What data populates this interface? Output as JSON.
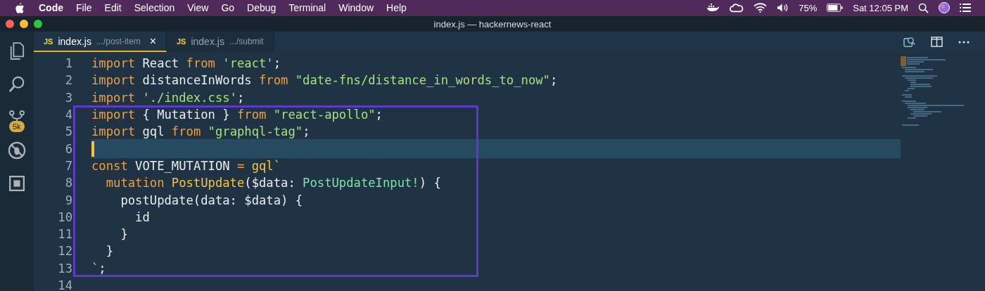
{
  "menubar": {
    "app_name": "Code",
    "menus": [
      "File",
      "Edit",
      "Selection",
      "View",
      "Go",
      "Debug",
      "Terminal",
      "Window",
      "Help"
    ],
    "battery": "75%",
    "clock": "Sat 12:05 PM"
  },
  "window": {
    "title": "index.js — hackernews-react"
  },
  "activity_bar": {
    "items": [
      {
        "kind": "files",
        "selected": false
      },
      {
        "kind": "search",
        "selected": false
      },
      {
        "kind": "source-control",
        "selected": false,
        "badge": "5k"
      },
      {
        "kind": "debug",
        "selected": false
      },
      {
        "kind": "extensions",
        "selected": false
      }
    ]
  },
  "tabs": [
    {
      "lang": "JS",
      "name": "index.js",
      "path": ".../post-item",
      "selected": true,
      "close": "×"
    },
    {
      "lang": "JS",
      "name": "index.js",
      "path": ".../submit",
      "selected": false
    }
  ],
  "editor": {
    "lines": [
      {
        "number": "1",
        "active": false,
        "tokens": [
          {
            "kind": "keyword",
            "text": "import"
          },
          {
            "kind": "plain",
            "text": " React "
          },
          {
            "kind": "keyword",
            "text": "from "
          },
          {
            "kind": "string",
            "text": "'react'"
          },
          {
            "kind": "plain",
            "text": ";"
          }
        ]
      },
      {
        "number": "2",
        "active": false,
        "tokens": [
          {
            "kind": "keyword",
            "text": "import"
          },
          {
            "kind": "plain",
            "text": " distanceInWords "
          },
          {
            "kind": "keyword",
            "text": "from "
          },
          {
            "kind": "string",
            "text": "\"date-fns/distance_in_words_to_now\""
          },
          {
            "kind": "plain",
            "text": ";"
          }
        ]
      },
      {
        "number": "3",
        "active": false,
        "tokens": [
          {
            "kind": "keyword",
            "text": "import "
          },
          {
            "kind": "string",
            "text": "'./index.css'"
          },
          {
            "kind": "plain",
            "text": ";"
          }
        ]
      },
      {
        "number": "4",
        "active": false,
        "tokens": [
          {
            "kind": "keyword",
            "text": "import"
          },
          {
            "kind": "plain",
            "text": " { Mutation } "
          },
          {
            "kind": "keyword",
            "text": "from "
          },
          {
            "kind": "string",
            "text": "\"react-apollo\""
          },
          {
            "kind": "plain",
            "text": ";"
          }
        ]
      },
      {
        "number": "5",
        "active": false,
        "tokens": [
          {
            "kind": "keyword",
            "text": "import"
          },
          {
            "kind": "plain",
            "text": " gql "
          },
          {
            "kind": "keyword",
            "text": "from "
          },
          {
            "kind": "string",
            "text": "\"graphql-tag\""
          },
          {
            "kind": "plain",
            "text": ";"
          }
        ]
      },
      {
        "number": "6",
        "active": true
      },
      {
        "number": "7",
        "active": false,
        "tokens": [
          {
            "kind": "keyword",
            "text": "const"
          },
          {
            "kind": "plain",
            "text": " VOTE_MUTATION "
          },
          {
            "kind": "keyword",
            "text": "= "
          },
          {
            "kind": "function",
            "text": "gql"
          },
          {
            "kind": "string",
            "text": "`"
          }
        ]
      },
      {
        "number": "8",
        "active": false,
        "tokens": [
          {
            "kind": "keyword",
            "text": "  mutation "
          },
          {
            "kind": "function",
            "text": "PostUpdate"
          },
          {
            "kind": "plain",
            "text": "($data: "
          },
          {
            "kind": "type",
            "text": "PostUpdateInput!"
          },
          {
            "kind": "plain",
            "text": ") {"
          }
        ]
      },
      {
        "number": "9",
        "active": false,
        "tokens": [
          {
            "kind": "plain",
            "text": "    postUpdate(data: $data) {"
          }
        ]
      },
      {
        "number": "10",
        "active": false,
        "tokens": [
          {
            "kind": "plain",
            "text": "      id"
          }
        ]
      },
      {
        "number": "11",
        "active": false,
        "tokens": [
          {
            "kind": "plain",
            "text": "    }"
          }
        ]
      },
      {
        "number": "12",
        "active": false,
        "tokens": [
          {
            "kind": "plain",
            "text": "  }"
          }
        ]
      },
      {
        "number": "13",
        "active": false,
        "tokens": [
          {
            "kind": "string",
            "text": "`"
          },
          {
            "kind": "plain",
            "text": ";"
          }
        ]
      },
      {
        "number": "14",
        "active": false
      }
    ]
  }
}
